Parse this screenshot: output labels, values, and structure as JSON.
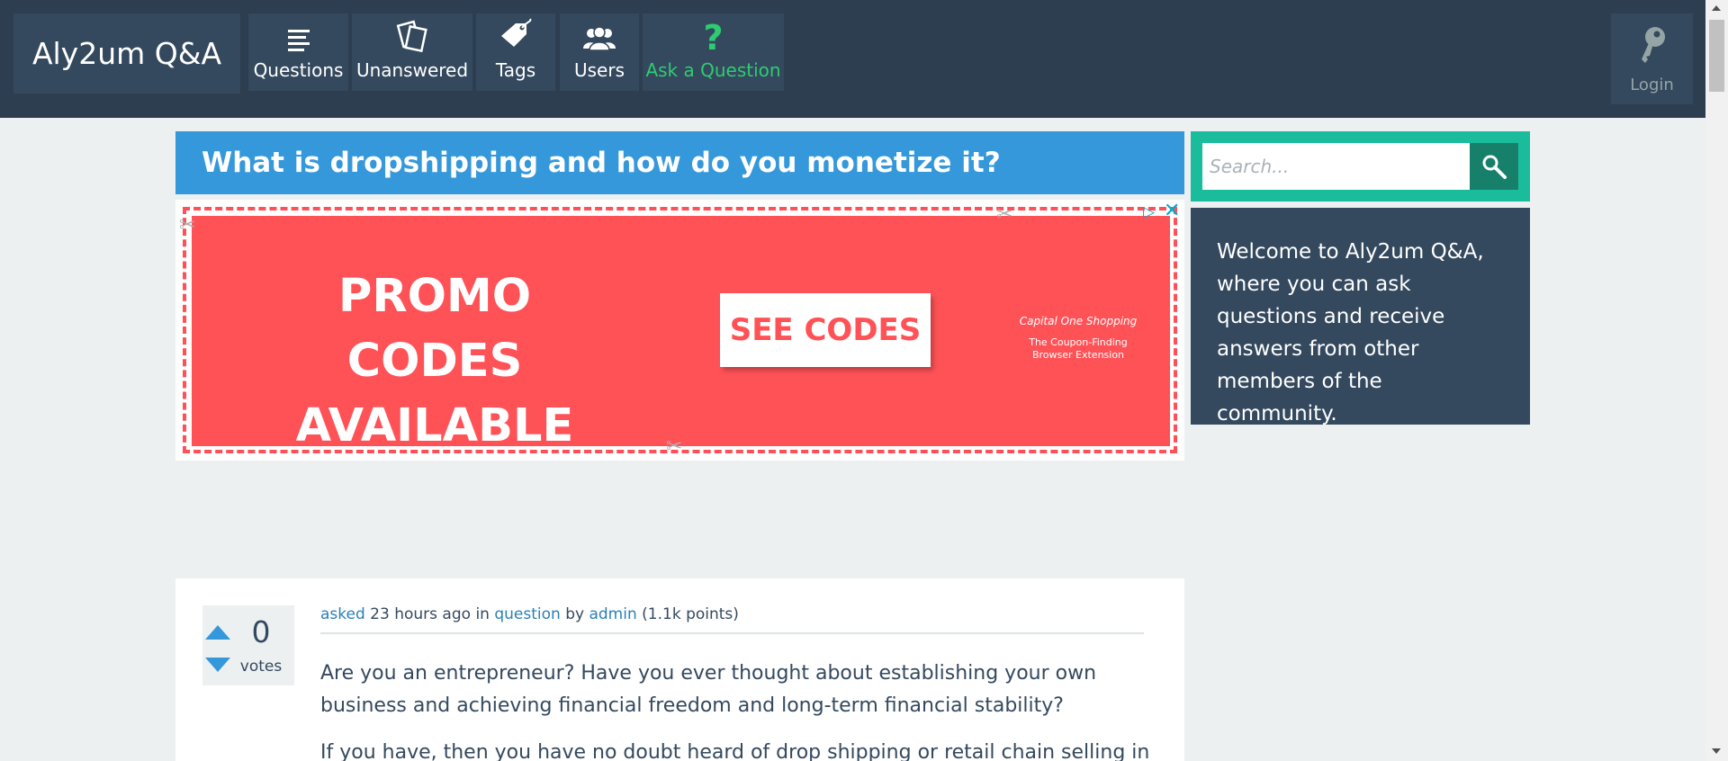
{
  "header": {
    "brand": "Aly2um Q&A",
    "nav": [
      {
        "label": "Questions",
        "icon": "list-icon"
      },
      {
        "label": "Unanswered",
        "icon": "cards-icon"
      },
      {
        "label": "Tags",
        "icon": "tag-icon"
      },
      {
        "label": "Users",
        "icon": "users-icon"
      },
      {
        "label": "Ask a Question",
        "icon": "question-mark-icon"
      }
    ],
    "login_label": "Login"
  },
  "question": {
    "title": "What is dropshipping and how do you monetize it?",
    "votes": "0",
    "votes_label": "votes",
    "meta": {
      "asked": "asked",
      "when": "23 hours ago",
      "in_text": "in",
      "category": "question",
      "by_text": "by",
      "author": "admin",
      "points": "(1.1k points)"
    },
    "body": [
      "Are you an entrepreneur? Have you ever thought about establishing your own business and achieving financial freedom and long-term financial stability?",
      "If you have, then you have no doubt heard of drop shipping or retail chain selling in"
    ]
  },
  "ad": {
    "headline": "PROMO CODES AVAILABLE",
    "cta": "SEE CODES",
    "brand_name": "Capital One Shopping",
    "brand_tagline": "The Coupon-Finding Browser Extension",
    "choices_icon": "▷",
    "close_icon": "✕",
    "accent": "#ff5257"
  },
  "sidebar": {
    "search_placeholder": "Search...",
    "welcome_text": "Welcome to Aly2um Q&A, where you can ask questions and receive answers from other members of the community."
  },
  "colors": {
    "topbar": "#2c3e50",
    "nav_bg": "#34495e",
    "title_bg": "#3498db",
    "ask_green": "#2ecc71",
    "search_bg": "#1abc9c",
    "link": "#2980b9"
  }
}
